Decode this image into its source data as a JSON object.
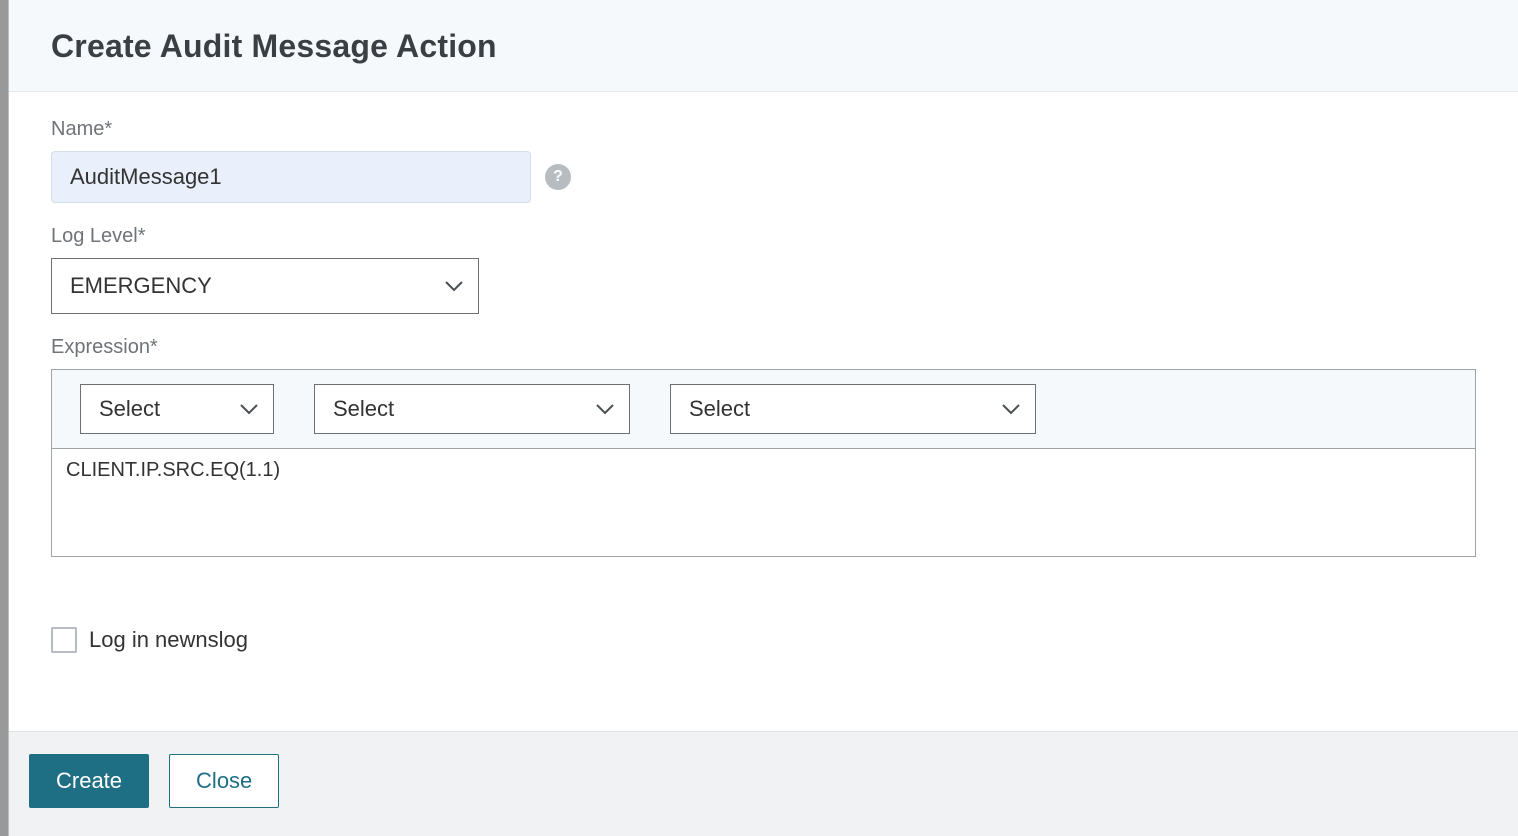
{
  "header": {
    "title": "Create Audit Message Action"
  },
  "form": {
    "name": {
      "label": "Name*",
      "value": "AuditMessage1",
      "help_glyph": "?"
    },
    "log_level": {
      "label": "Log Level*",
      "selected": "EMERGENCY"
    },
    "expression": {
      "label": "Expression*",
      "toolbar": {
        "sel1": "Select",
        "sel2": "Select",
        "sel3": "Select"
      },
      "value": "CLIENT.IP.SRC.EQ(1.1)"
    },
    "log_newnslog": {
      "label": "Log in newnslog",
      "checked": false
    }
  },
  "footer": {
    "create": "Create",
    "close": "Close"
  }
}
